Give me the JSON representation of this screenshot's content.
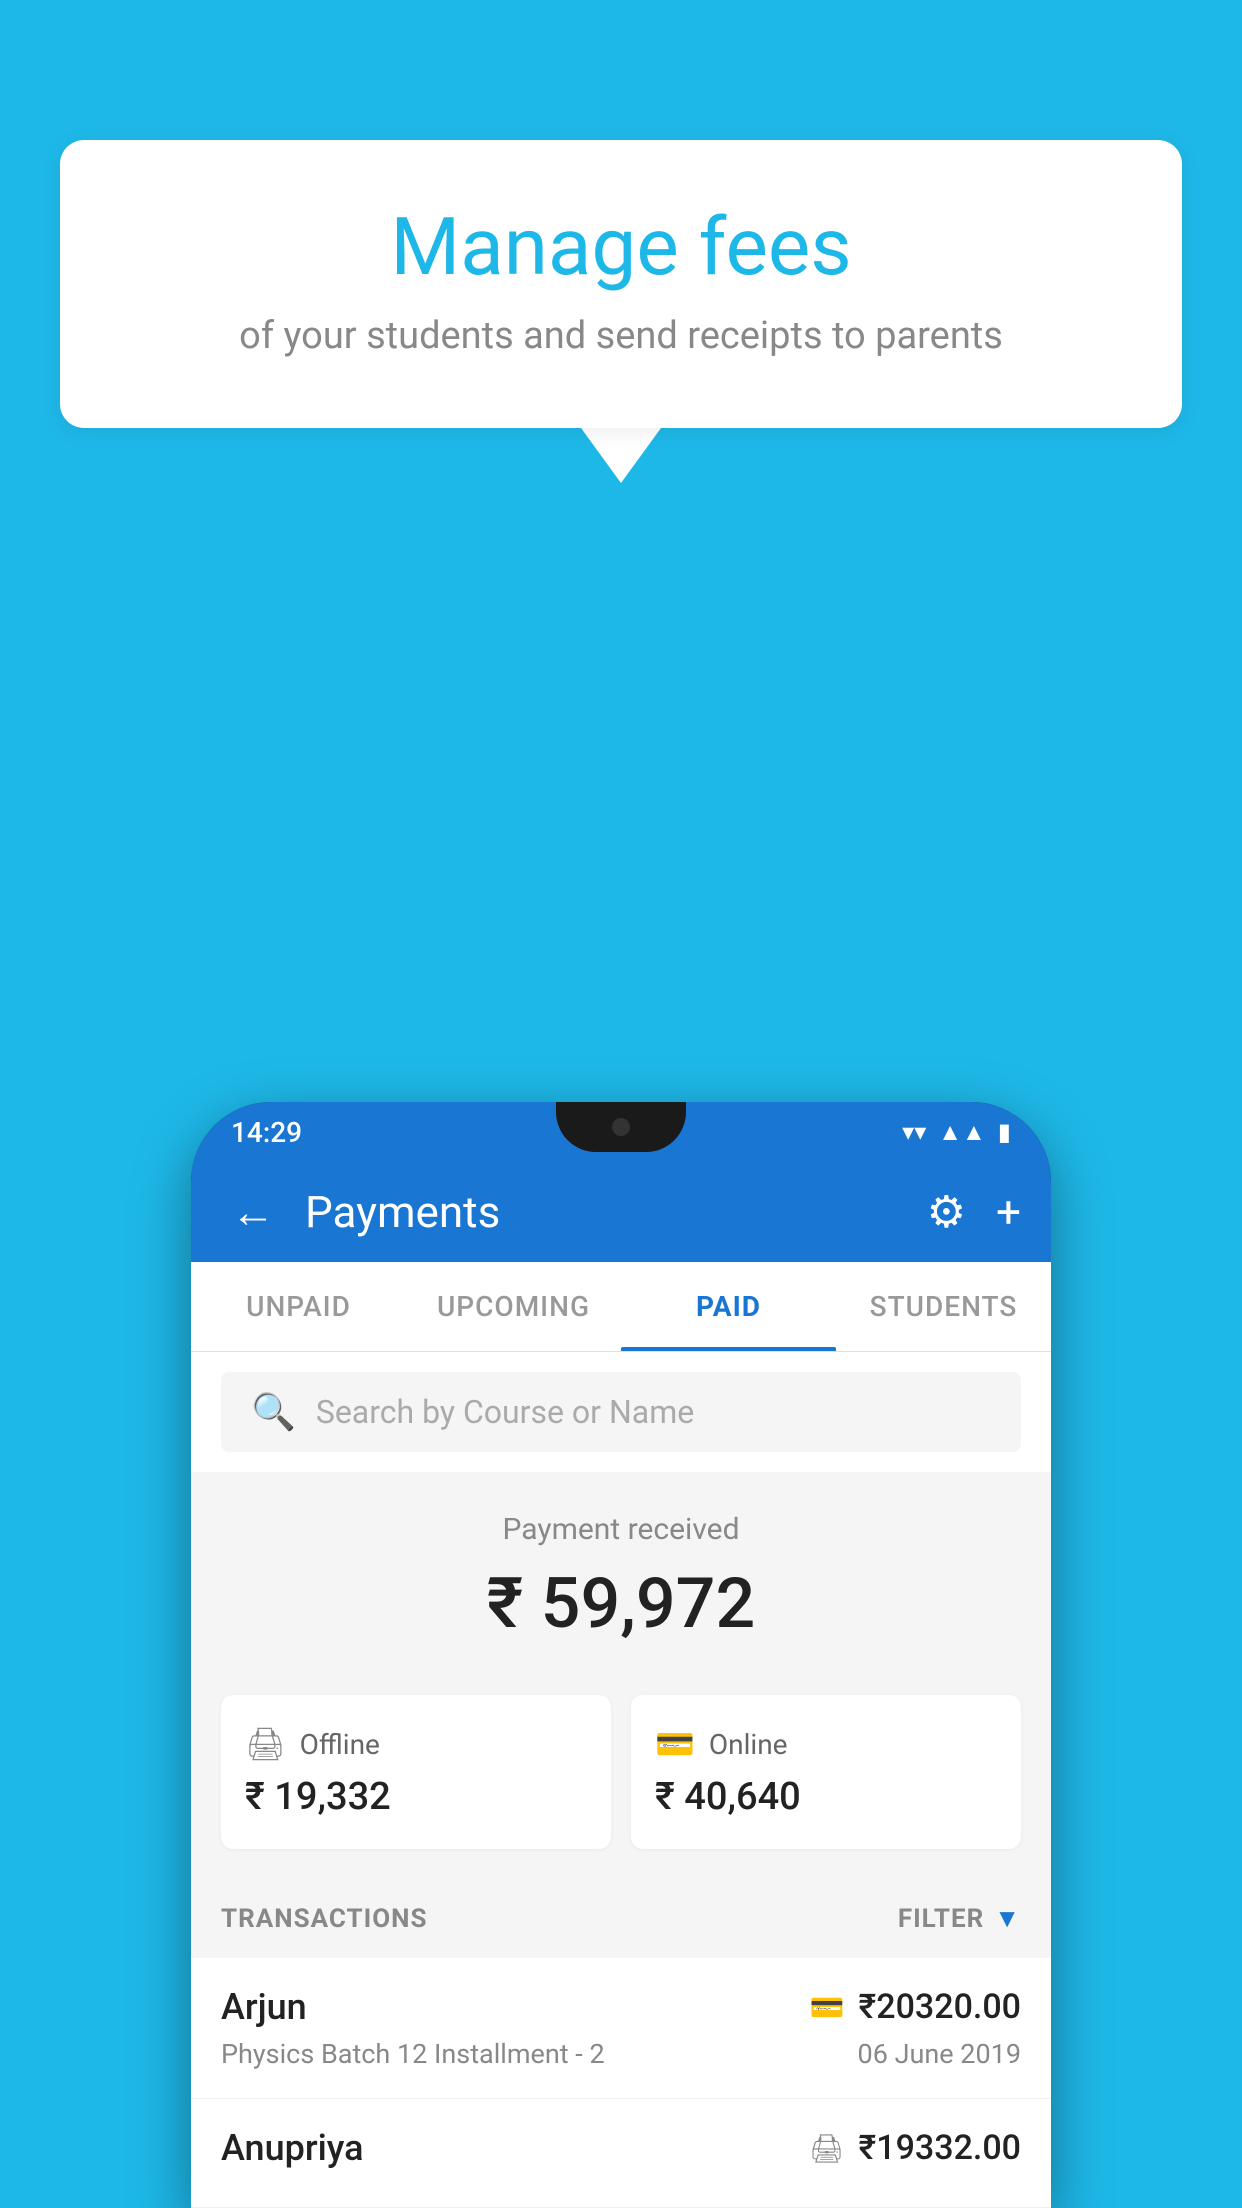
{
  "background_color": "#1eb8e8",
  "speech_bubble": {
    "title": "Manage fees",
    "subtitle": "of your students and send receipts to parents"
  },
  "status_bar": {
    "time": "14:29",
    "icons": [
      "wifi",
      "signal",
      "battery"
    ]
  },
  "app_bar": {
    "title": "Payments",
    "back_label": "←",
    "gear_label": "⚙",
    "plus_label": "+"
  },
  "tabs": [
    {
      "label": "UNPAID",
      "active": false
    },
    {
      "label": "UPCOMING",
      "active": false
    },
    {
      "label": "PAID",
      "active": true
    },
    {
      "label": "STUDENTS",
      "active": false
    }
  ],
  "search": {
    "placeholder": "Search by Course or Name"
  },
  "payment_received": {
    "label": "Payment received",
    "amount": "₹ 59,972"
  },
  "payment_cards": [
    {
      "type": "Offline",
      "icon": "💳",
      "amount": "₹ 19,332"
    },
    {
      "type": "Online",
      "icon": "💳",
      "amount": "₹ 40,640"
    }
  ],
  "transactions_header": {
    "label": "TRANSACTIONS",
    "filter_label": "FILTER"
  },
  "transactions": [
    {
      "name": "Arjun",
      "description": "Physics Batch 12 Installment - 2",
      "amount": "₹20320.00",
      "date": "06 June 2019",
      "type": "online"
    },
    {
      "name": "Anupriya",
      "description": "",
      "amount": "₹19332.00",
      "date": "",
      "type": "offline"
    }
  ]
}
